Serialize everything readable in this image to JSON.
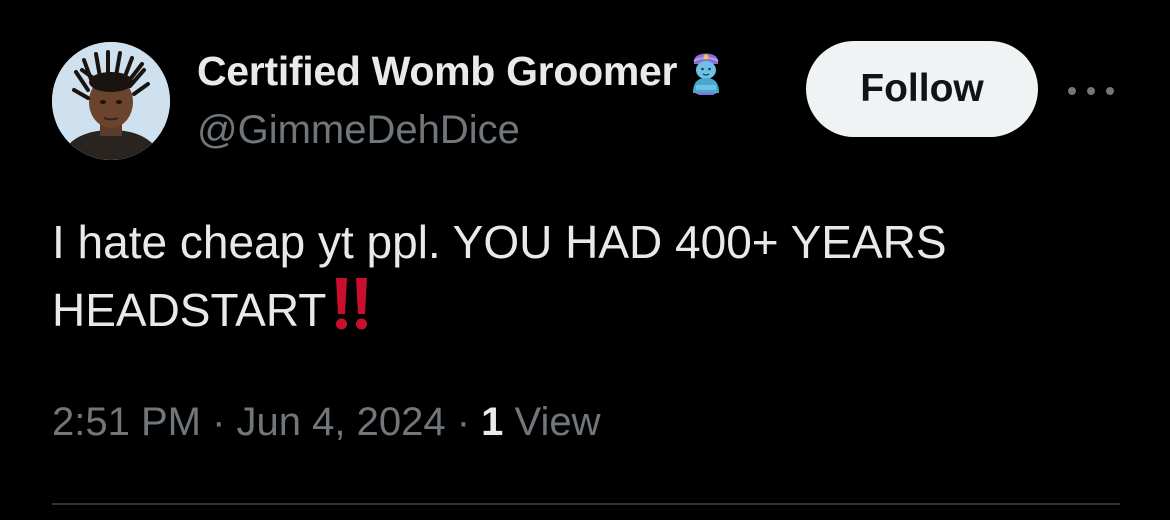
{
  "author": {
    "display_name": "Certified Womb Groomer",
    "handle": "@GimmeDehDice",
    "name_emoji": "genie-emoji",
    "avatar": "profile-photo"
  },
  "actions": {
    "follow_label": "Follow",
    "more_icon": "more-horizontal-icon"
  },
  "tweet": {
    "line1": "I hate cheap yt ppl. YOU HAD 400+ YEARS",
    "line2": "HEADSTART",
    "emoji": "double-exclamation-mark",
    "emoji_color": "#c8102e"
  },
  "meta": {
    "time": "2:51 PM",
    "sep1": " · ",
    "date": "Jun 4, 2024",
    "sep2": " · ",
    "view_count": "1",
    "view_label": " View"
  },
  "colors": {
    "background": "#000000",
    "primary_text": "#e7e9ea",
    "secondary_text": "#71767b",
    "follow_bg": "#eff3f4",
    "divider": "#2f3336"
  }
}
